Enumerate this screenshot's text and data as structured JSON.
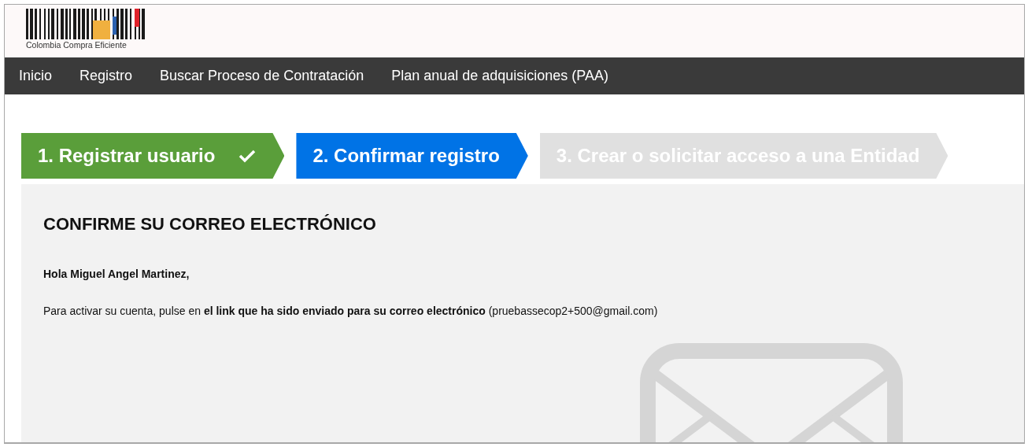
{
  "header": {
    "logo_text": "Colombia Compra Eficiente"
  },
  "nav": {
    "items": [
      "Inicio",
      "Registro",
      "Buscar Proceso de Contratación",
      "Plan anual de adquisiciones (PAA)"
    ]
  },
  "steps": [
    {
      "label": "1. Registrar usuario",
      "completed": true,
      "selected": false
    },
    {
      "label": "2. Confirmar registro",
      "completed": false,
      "selected": true
    },
    {
      "label": "3. Crear o solicitar acceso a una Entidad",
      "completed": false,
      "selected": false
    }
  ],
  "panel": {
    "heading": "CONFIRME SU CORREO ELECTRÓNICO",
    "greeting": "Hola Miguel Angel Martinez,",
    "message": "Para activar su cuenta, pulse en  **el link que ha sido enviado para su correo electrónico** (pruebassecop2+500@gmail.com)"
  }
}
